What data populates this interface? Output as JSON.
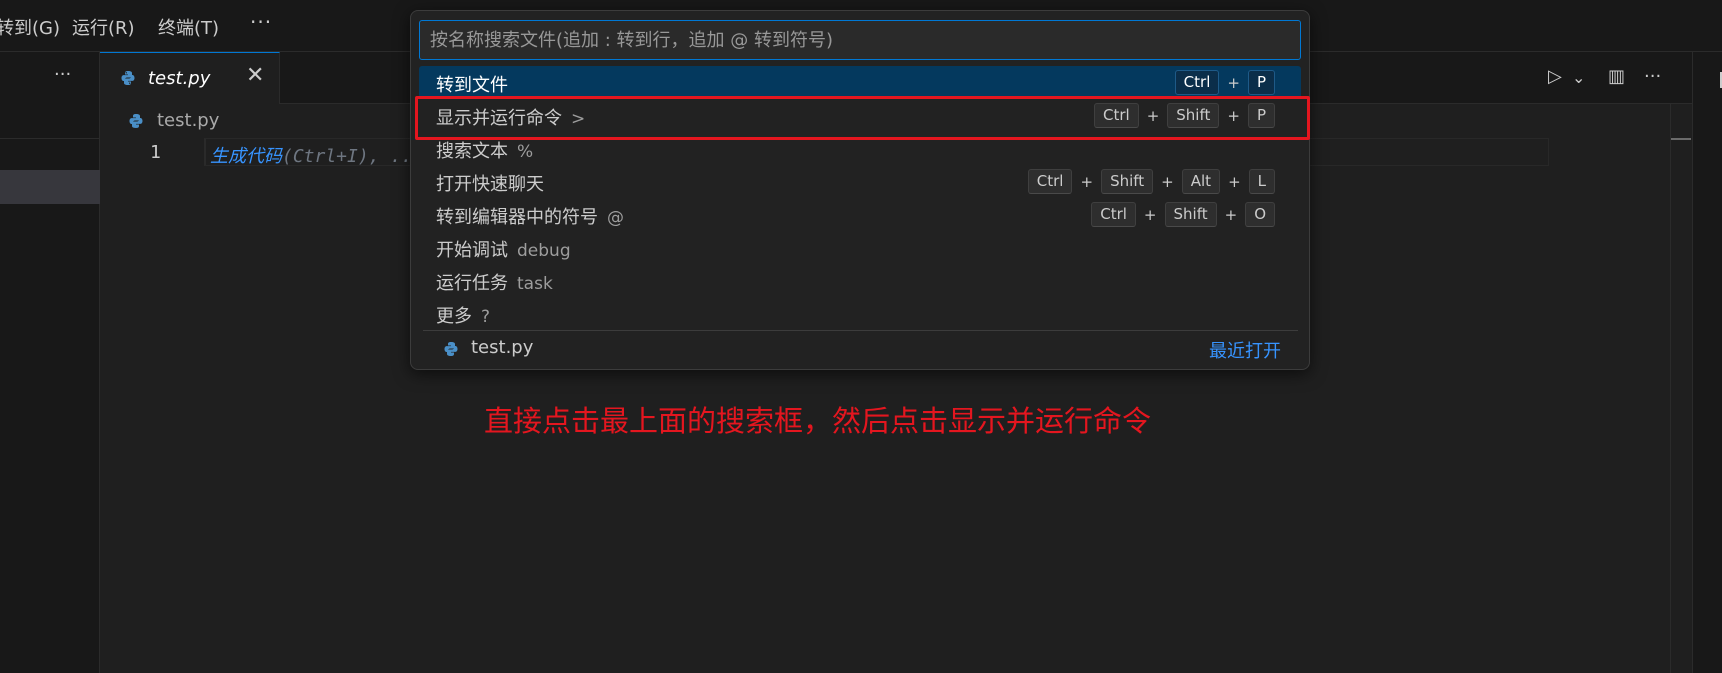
{
  "menu": {
    "items": [
      {
        "label": "转到(G)"
      },
      {
        "label": "运行(R)"
      },
      {
        "label": "终端(T)"
      }
    ],
    "more": "···"
  },
  "sidebar": {
    "more": "···"
  },
  "tab": {
    "label": "test.py",
    "close": "✕"
  },
  "editor_actions": {
    "run": "▷",
    "dropdown": "⌄",
    "split": "▥",
    "more": "···"
  },
  "breadcrumb": {
    "file": "test.py"
  },
  "editor": {
    "line_number": "1",
    "hint_link": "生成代码",
    "hint_rest": "(Ctrl+I), ..."
  },
  "quick_pick": {
    "placeholder": "按名称搜索文件(追加 : 转到行，追加 @ 转到符号)",
    "rows": [
      {
        "label": "转到文件",
        "prefix": "",
        "keys": [
          "Ctrl",
          "P"
        ]
      },
      {
        "label": "显示并运行命令",
        "prefix": ">",
        "keys": [
          "Ctrl",
          "Shift",
          "P"
        ]
      },
      {
        "label": "搜索文本",
        "prefix": "%",
        "keys": []
      },
      {
        "label": "打开快速聊天",
        "prefix": "",
        "keys": [
          "Ctrl",
          "Shift",
          "Alt",
          "L"
        ]
      },
      {
        "label": "转到编辑器中的符号",
        "prefix": "@",
        "keys": [
          "Ctrl",
          "Shift",
          "O"
        ]
      },
      {
        "label": "开始调试",
        "prefix": "debug",
        "keys": []
      },
      {
        "label": "运行任务",
        "prefix": "task",
        "keys": []
      },
      {
        "label": "更多",
        "prefix": "?",
        "keys": []
      }
    ],
    "recent": {
      "file": "test.py",
      "tag": "最近打开"
    }
  },
  "annotation": {
    "text": "直接点击最上面的搜索框，然后点击显示并运行命令"
  },
  "colors": {
    "accent": "#0078d4",
    "active_row": "#04395e",
    "annotation_red": "#e4161f",
    "link_blue": "#3794ff"
  }
}
